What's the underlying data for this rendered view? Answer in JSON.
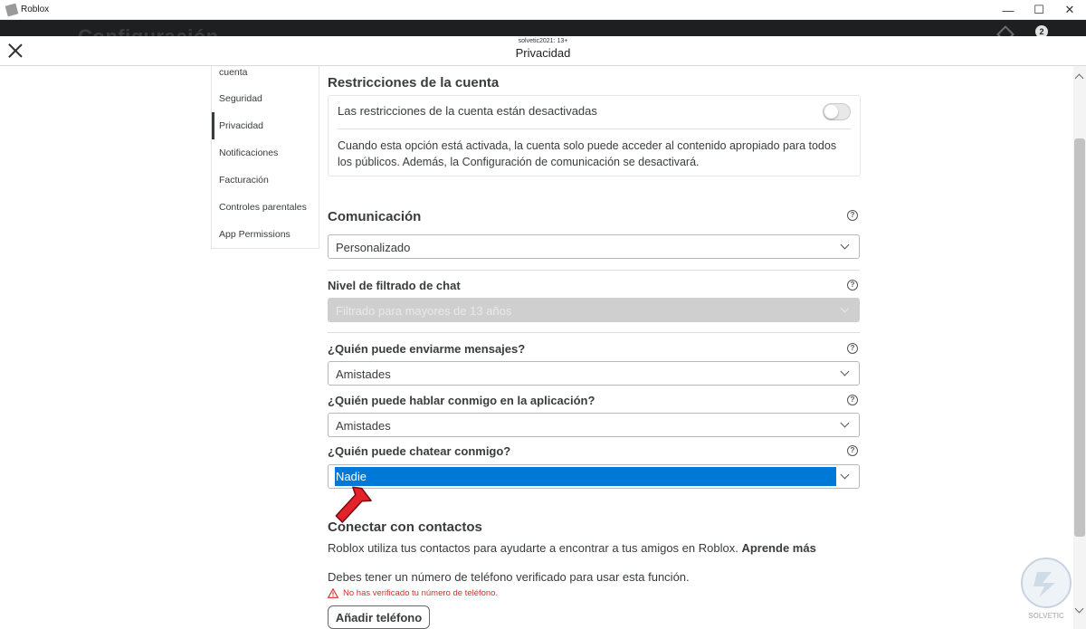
{
  "window": {
    "app_title": "Roblox",
    "min_glyph": "—",
    "max_glyph": "☐",
    "close_glyph": "✕"
  },
  "background": {
    "ghost_title": "Configuración",
    "badge": "2"
  },
  "header": {
    "username": "solvetic2021: 13+",
    "title": "Privacidad"
  },
  "sidebar": {
    "items": [
      {
        "label": "cuenta",
        "active": false
      },
      {
        "label": "Seguridad",
        "active": false
      },
      {
        "label": "Privacidad",
        "active": true
      },
      {
        "label": "Notificaciones",
        "active": false
      },
      {
        "label": "Facturación",
        "active": false
      },
      {
        "label": "Controles parentales",
        "active": false
      },
      {
        "label": "App Permissions",
        "active": false
      }
    ]
  },
  "restrictions": {
    "heading": "Restricciones de la cuenta",
    "toggle_label": "Las restricciones de la cuenta están desactivadas",
    "toggle_on": false,
    "description": "Cuando esta opción está activada, la cuenta solo puede acceder al contenido apropiado para todos los públicos. Además, la Configuración de comunicación se desactivará."
  },
  "communication": {
    "heading": "Comunicación",
    "preset_value": "Personalizado",
    "chat_filter_label": "Nivel de filtrado de chat",
    "chat_filter_value": "Filtrado para mayores de 13 años",
    "messages_label": "¿Quién puede enviarme mensajes?",
    "messages_value": "Amistades",
    "app_talk_label": "¿Quién puede hablar conmigo en la aplicación?",
    "app_talk_value": "Amistades",
    "chat_label": "¿Quién puede chatear conmigo?",
    "chat_value": "Nadie",
    "help_glyph": "?"
  },
  "contacts": {
    "heading": "Conectar con contactos",
    "description": "Roblox utiliza tus contactos para ayudarte a encontrar a tus amigos en Roblox.",
    "learn_more": "Aprende más",
    "requirement": "Debes tener un número de teléfono verificado para usar esta función.",
    "warning": "No has verificado tu número de teléfono.",
    "add_phone_button": "Añadir teléfono"
  },
  "colors": {
    "selection": "#0078d7",
    "warning": "#d32f2f",
    "arrow": "#e3222b",
    "text": "#393b3d"
  },
  "watermark": {
    "text": "SOLVETIC"
  }
}
